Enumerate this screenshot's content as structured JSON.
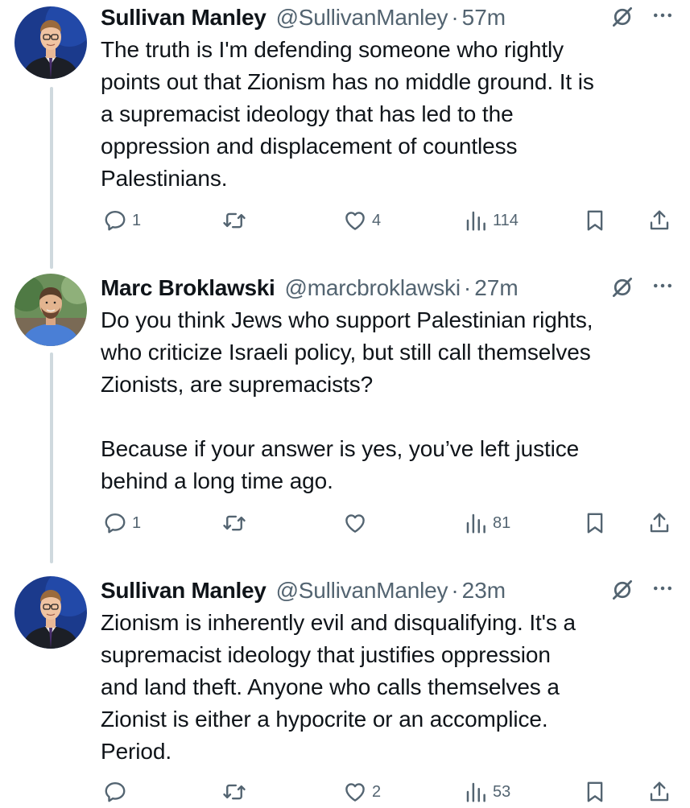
{
  "icons": {
    "reply": "reply-icon",
    "retweet": "retweet-icon",
    "like": "heart-icon",
    "views": "views-chart-icon",
    "bookmark": "bookmark-icon",
    "share": "share-icon",
    "grok": "grok-icon",
    "more": "more-icon"
  },
  "colors": {
    "text": "#0f1419",
    "secondary": "#536471",
    "thread_line": "#cfd9de"
  },
  "tweets": [
    {
      "name": "Sullivan Manley",
      "handle": "@SullivanManley",
      "separator": "·",
      "time": "57m",
      "text": "The truth is I'm defending someone who rightly\npoints out that Zionism has no middle ground. It is\na supremacist ideology that has led to the\noppression and displacement of countless\nPalestinians.",
      "replies": "1",
      "retweets": "",
      "likes": "4",
      "views": "114"
    },
    {
      "name": "Marc Broklawski",
      "handle": "@marcbroklawski",
      "separator": "·",
      "time": "27m",
      "text": "Do you think Jews who support Palestinian rights,\nwho criticize Israeli policy, but still call themselves\nZionists, are supremacists?\n\nBecause if your answer is yes, you’ve left justice\nbehind a long time ago.",
      "replies": "1",
      "retweets": "",
      "likes": "",
      "views": "81"
    },
    {
      "name": "Sullivan Manley",
      "handle": "@SullivanManley",
      "separator": "·",
      "time": "23m",
      "text": "Zionism is inherently evil and disqualifying. It's a\nsupremacist ideology that justifies oppression\nand land theft. Anyone who calls themselves a\nZionist is either a hypocrite or an accomplice.\nPeriod.",
      "replies": "",
      "retweets": "",
      "likes": "2",
      "views": "53"
    }
  ]
}
